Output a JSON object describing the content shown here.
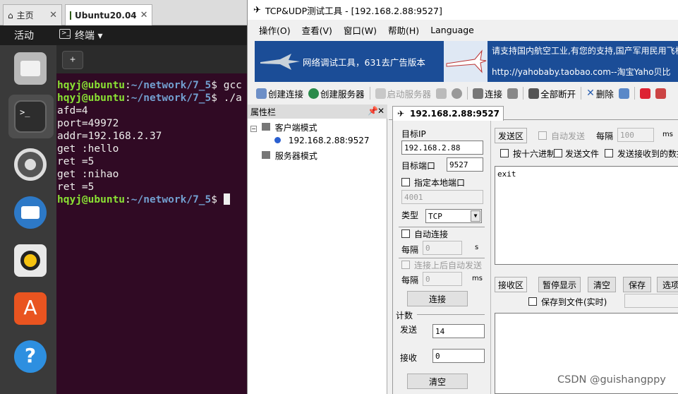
{
  "vm_tabs": [
    {
      "label": "主页",
      "icon": "home-icon"
    },
    {
      "label": "Ubuntu20.04",
      "icon": "vm-icon"
    }
  ],
  "topbar": {
    "activities": "活动",
    "app_menu": "终端"
  },
  "dock": {
    "items": [
      "files-icon",
      "terminal-icon",
      "settings-icon",
      "thunderbird-icon",
      "rhythmbox-icon",
      "software-icon",
      "help-icon"
    ]
  },
  "terminal": {
    "new_tab_label": "+",
    "lines": [
      {
        "user": "hqyj@ubuntu",
        "path": "~/network/7_5",
        "cmd": "$ gcc"
      },
      {
        "user": "hqyj@ubuntu",
        "path": "~/network/7_5",
        "cmd": "$ ./a"
      },
      {
        "text": "afd=4"
      },
      {
        "text": "port=49972"
      },
      {
        "text": "addr=192.168.2.37"
      },
      {
        "text": "get :hello"
      },
      {
        "text": "ret =5"
      },
      {
        "text": "get :nihao"
      },
      {
        "text": "ret =5"
      },
      {
        "user": "hqyj@ubuntu",
        "path": "~/network/7_5",
        "cmd": "$ "
      }
    ]
  },
  "app": {
    "title": "TCP&UDP测试工具 - [192.168.2.88:9527]",
    "menu": [
      "操作(O)",
      "查看(V)",
      "窗口(W)",
      "帮助(H)",
      "Language"
    ],
    "banner": {
      "left_text": "网络调试工具，631去广告版本",
      "right_line1": "请支持国内航空工业,有您的支持,国产军用民用飞机",
      "right_line2": "http://yahobaby.taobao.com--淘宝Yaho贝比"
    },
    "toolbar": [
      {
        "label": "创建连接",
        "enabled": true
      },
      {
        "label": "创建服务器",
        "enabled": true
      },
      {
        "label": "启动服务器",
        "enabled": false
      },
      {
        "label": "连接",
        "enabled": true
      },
      {
        "label": "全部断开",
        "enabled": true
      },
      {
        "label": "删除",
        "enabled": true
      }
    ],
    "property_panel": {
      "title": "属性栏",
      "pin": "ᵖ",
      "close": "✕",
      "client_mode": "客户端模式",
      "client_item": "192.168.2.88:9527",
      "server_mode": "服务器模式"
    },
    "tab": {
      "label": "192.168.2.88:9527"
    },
    "conn": {
      "target_ip_label": "目标IP",
      "target_ip": "192.168.2.88",
      "target_port_label": "目标端口",
      "target_port": "9527",
      "local_port_label": "指定本地端口",
      "local_port": "4001",
      "type_label": "类型",
      "type_value": "TCP",
      "auto_connect_label": "自动连接",
      "interval_label": "每隔",
      "interval_value": "0",
      "interval_unit": "s",
      "auto_send_label": "连接上后自动发送",
      "interval2_label": "每隔",
      "interval2_value": "0",
      "interval2_unit": "ms",
      "connect_button": "连接",
      "count_label": "计数",
      "send_label": "发送",
      "send_value": "14",
      "recv_label": "接收",
      "recv_value": "0",
      "clear_button": "清空"
    },
    "send": {
      "area_label": "发送区",
      "auto_send_label": "自动发送",
      "interval_label": "每隔",
      "interval_value": "100",
      "interval_unit": "ms",
      "hex_label": "按十六进制",
      "send_file_label": "发送文件",
      "send_recv_label": "发送接收到的数据",
      "text": "exit"
    },
    "recv": {
      "area_label": "接收区",
      "pause_button": "暂停显示",
      "clear_button": "清空",
      "save_button": "保存",
      "options_button": "选项",
      "save_file_label": "保存到文件(实时)"
    }
  },
  "watermark": "CSDN @guishangppy"
}
